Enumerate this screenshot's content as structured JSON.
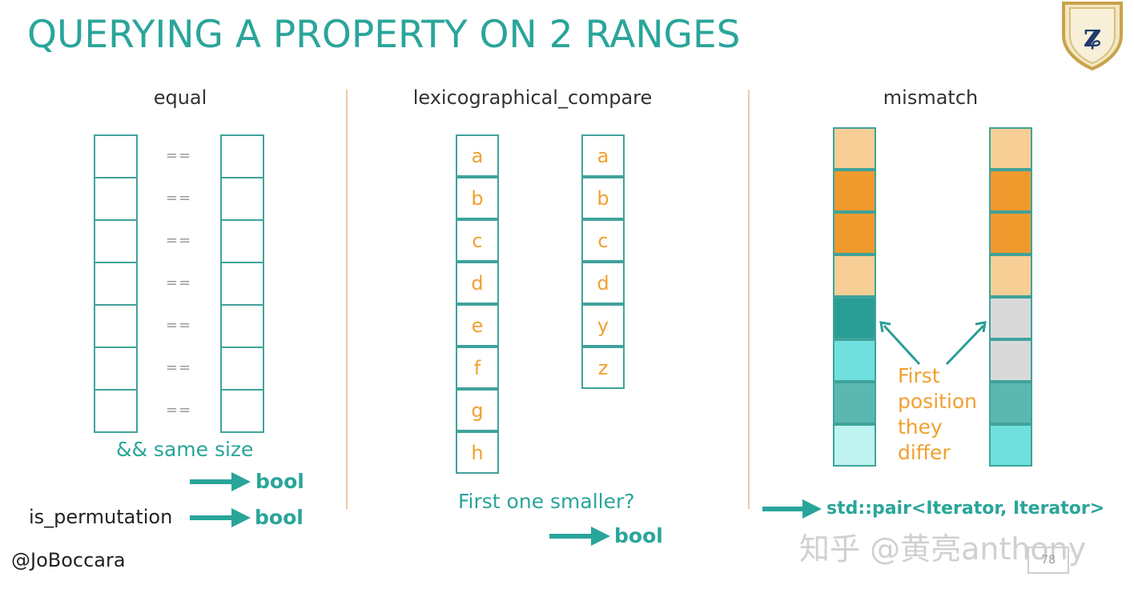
{
  "title": "QUERYING A PROPERTY ON 2 RANGES",
  "columns": {
    "equal": {
      "heading": "equal",
      "operator": "==",
      "same_size_note": "&& same size",
      "result": "bool",
      "permutation_label": "is_permutation",
      "permutation_result": "bool"
    },
    "lexicographical": {
      "heading": "lexicographical_compare",
      "left_letters": [
        "a",
        "b",
        "c",
        "d",
        "e",
        "f",
        "g",
        "h"
      ],
      "right_letters": [
        "a",
        "b",
        "c",
        "d",
        "y",
        "z"
      ],
      "question": "First one smaller?",
      "result": "bool"
    },
    "mismatch": {
      "heading": "mismatch",
      "left_colors": [
        "#f7ce96",
        "#f09a2e",
        "#f09a2e",
        "#f7ce96",
        "#2a9e96",
        "#6fe0de",
        "#5ab8b0",
        "#bff3f1"
      ],
      "right_colors": [
        "#f7ce96",
        "#f09a2e",
        "#f09a2e",
        "#f7ce96",
        "#d9d9d9",
        "#d9d9d9",
        "#5ab8b0",
        "#6fe0de"
      ],
      "annotation": [
        "First",
        "position",
        "they",
        "differ"
      ],
      "result": "std::pair<Iterator, Iterator>"
    }
  },
  "footer": {
    "handle": "@JoBoccara",
    "watermark": "知乎 @黄亮anthony",
    "page_number": "78"
  },
  "colors": {
    "teal": "#2aa59a",
    "orange": "#f0a030",
    "separator": "#f0c9a8"
  }
}
